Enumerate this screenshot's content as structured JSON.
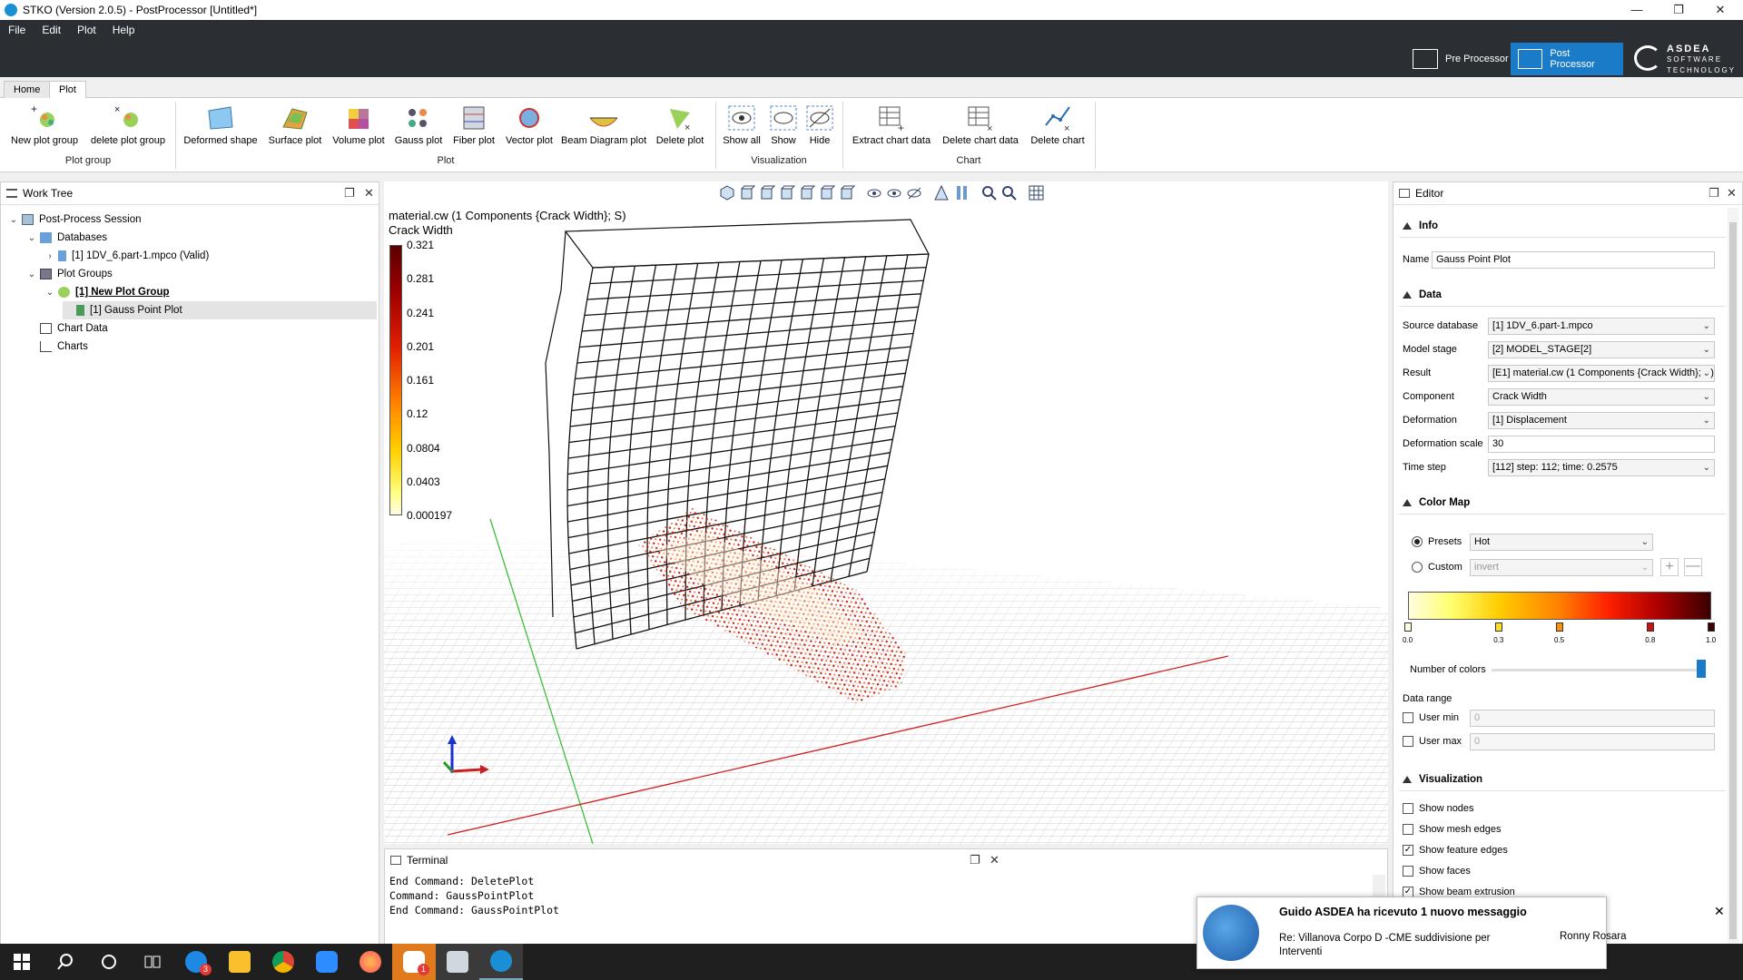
{
  "window": {
    "title": "STKO (Version 2.0.5) - PostProcessor [Untitled*]"
  },
  "menu": [
    "File",
    "Edit",
    "Plot",
    "Help"
  ],
  "perspectives": {
    "pre": "Pre Processor",
    "post": "Post Processor",
    "logo_line1": "ASDEA",
    "logo_line2": "SOFTWARE",
    "logo_line3": "TECHNOLOGY"
  },
  "ribbon": {
    "tabs": [
      "Home",
      "Plot"
    ],
    "buttons": {
      "new_plot_group": "New plot group",
      "delete_plot_group": "delete plot group",
      "deformed_shape": "Deformed shape",
      "surface_plot": "Surface plot",
      "volume_plot": "Volume plot",
      "gauss_plot": "Gauss plot",
      "fiber_plot": "Fiber plot",
      "vector_plot": "Vector plot",
      "beam_diagram_plot": "Beam Diagram plot",
      "delete_plot": "Delete plot",
      "show_all": "Show all",
      "show": "Show",
      "hide": "Hide",
      "extract_chart_data": "Extract chart data",
      "delete_chart_data": "Delete chart data",
      "delete_chart": "Delete chart"
    },
    "groups": {
      "plot_group": "Plot group",
      "plot": "Plot",
      "visualization": "Visualization",
      "chart": "Chart"
    }
  },
  "worktree": {
    "title": "Work Tree",
    "items": {
      "session": "Post-Process Session",
      "databases": "Databases",
      "db1": "[1] 1DV_6.part-1.mpco (Valid)",
      "plot_groups": "Plot Groups",
      "group1": "[1] New Plot Group",
      "plot1": "[1] Gauss Point Plot",
      "chart_data": "Chart Data",
      "charts": "Charts"
    }
  },
  "viewport": {
    "plot_title_line1": "material.cw (1 Components {Crack Width}; S)",
    "plot_title_line2": "Crack Width",
    "colorbar_labels": [
      "0.321",
      "0.281",
      "0.241",
      "0.201",
      "0.161",
      "0.12",
      "0.0804",
      "0.0403",
      "0.000197"
    ]
  },
  "terminal": {
    "title": "Terminal",
    "lines": [
      "End Command: DeletePlot",
      "Command: GaussPointPlot",
      "End Command: GaussPointPlot"
    ]
  },
  "editor": {
    "title": "Editor",
    "sections": {
      "info": "Info",
      "data": "Data",
      "color_map": "Color Map",
      "visualization": "Visualization"
    },
    "info": {
      "name_label": "Name",
      "name_value": "Gauss Point Plot"
    },
    "data": {
      "source_database_label": "Source database",
      "source_database": "[1] 1DV_6.part-1.mpco",
      "model_stage_label": "Model stage",
      "model_stage": "[2] MODEL_STAGE[2]",
      "result_label": "Result",
      "result": "[E1] material.cw (1 Components {Crack Width}; S)",
      "component_label": "Component",
      "component": "Crack Width",
      "deformation_label": "Deformation",
      "deformation": "[1] Displacement",
      "deformation_scale_label": "Deformation scale",
      "deformation_scale": "30",
      "time_step_label": "Time step",
      "time_step": "[112] step: 112; time: 0.2575"
    },
    "color_map": {
      "presets_label": "Presets",
      "presets_value": "Hot",
      "custom_label": "Custom",
      "custom_value": "invert",
      "stops": [
        "0.0",
        "0.3",
        "0.5",
        "0.8",
        "1.0"
      ],
      "number_of_colors_label": "Number of colors",
      "data_range_label": "Data range",
      "user_min_label": "User min",
      "user_min_value": "0",
      "user_max_label": "User max",
      "user_max_value": "0"
    },
    "visualization": {
      "show_nodes": "Show nodes",
      "show_mesh_edges": "Show mesh edges",
      "show_feature_edges": "Show feature edges",
      "show_faces": "Show faces",
      "show_beam_extrusion": "Show beam extrusion"
    }
  },
  "notification": {
    "title": "Guido ASDEA ha ricevuto 1 nuovo messaggio",
    "subject": "Re: Villanova Corpo D -CME suddivisione per Interventi",
    "sender": "Ronny Rosara"
  },
  "taskbar": {
    "badge1": "3",
    "badge2": "1"
  }
}
